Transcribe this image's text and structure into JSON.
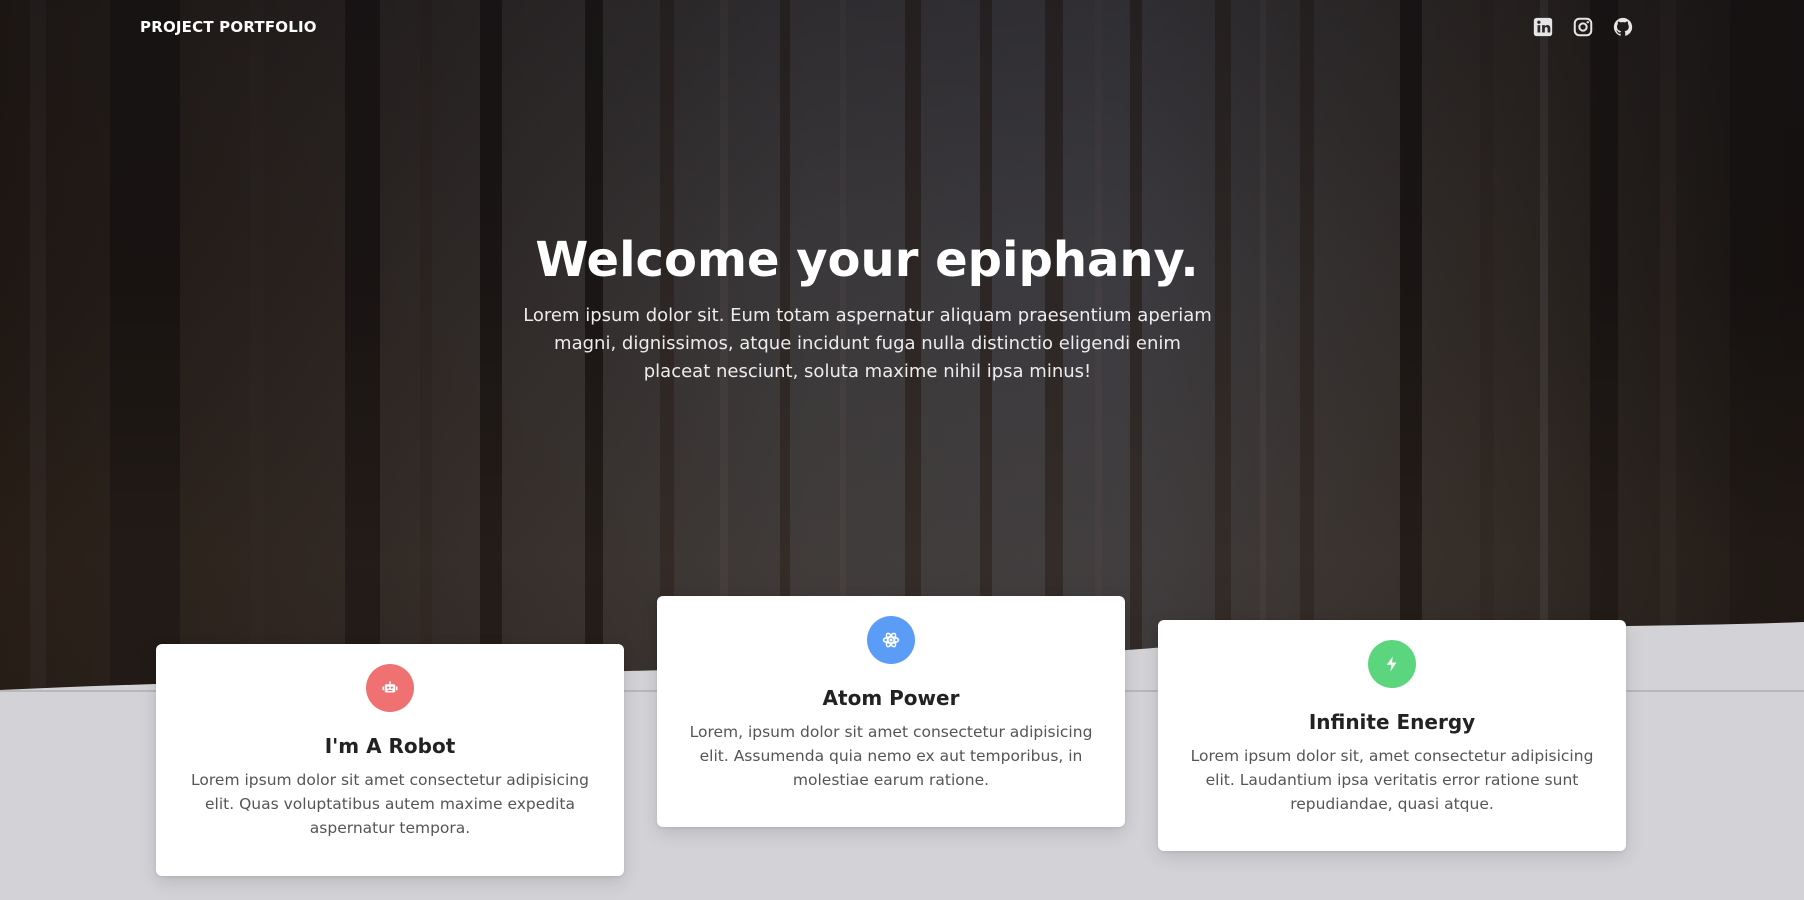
{
  "header": {
    "brand": "PROJECT PORTFOLIO",
    "social": [
      {
        "icon": "linkedin-icon"
      },
      {
        "icon": "instagram-icon"
      },
      {
        "icon": "github-icon"
      }
    ]
  },
  "hero": {
    "title": "Welcome your epiphany.",
    "subtitle": "Lorem ipsum dolor sit. Eum totam aspernatur aliquam praesentium aperiam magni, dignissimos, atque incidunt fuga nulla distinctio eligendi enim placeat nesciunt, soluta maxime nihil ipsa minus!"
  },
  "features": [
    {
      "title": "I'm A Robot",
      "text": "Lorem ipsum dolor sit amet consectetur adipisicing elit. Quas voluptatibus autem maxime expedita aspernatur tempora.",
      "icon": "robot-icon",
      "color": "#f07171"
    },
    {
      "title": "Atom Power",
      "text": "Lorem, ipsum dolor sit amet consectetur adipisicing elit. Assumenda quia nemo ex aut temporibus, in molestiae earum ratione.",
      "icon": "atom-icon",
      "color": "#5b9cf6"
    },
    {
      "title": "Infinite Energy",
      "text": "Lorem ipsum dolor sit, amet consectetur adipisicing elit. Laudantium ipsa veritatis error ratione sunt repudiandae, quasi atque.",
      "icon": "bolt-icon",
      "color": "#5cd67e"
    }
  ],
  "colors": {
    "page_background": "#d3d3d7",
    "hero_dark": "#2e2a2a"
  }
}
